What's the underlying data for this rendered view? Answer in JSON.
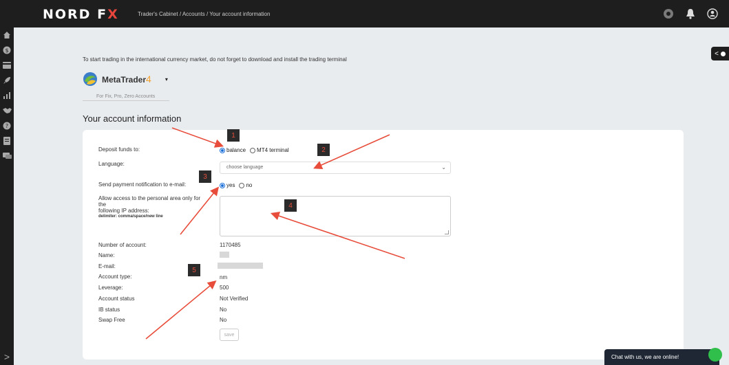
{
  "header": {
    "logo_part1": "NORD F",
    "logo_part2": "X",
    "breadcrumb": "Trader's Cabinet / Accounts / Your account information",
    "icons": [
      "support-icon",
      "bell-icon",
      "user-icon"
    ]
  },
  "sidebar": {
    "icons": [
      "home-icon",
      "dollar-icon",
      "card-icon",
      "rocket-icon",
      "chart-icon",
      "handshake-icon",
      "help-icon",
      "document-icon",
      "chat-icon"
    ],
    "expand_label": ">"
  },
  "collapse_tab": {
    "label": "<"
  },
  "intro": {
    "text": "To start trading in the international currency market, do not forget to download and install the trading terminal"
  },
  "terminal": {
    "name": "MetaTrader",
    "version": "4",
    "caret": "▾",
    "subtitle": "For Fix, Pro, Zero Accounts"
  },
  "section_title": "Your account information",
  "form": {
    "deposit_label": "Deposit funds to:",
    "deposit_options": [
      "balance",
      "MT4 terminal"
    ],
    "deposit_selected": "balance",
    "language_label": "Language:",
    "language_placeholder": "choose language",
    "notify_label": "Send payment notification to e-mail:",
    "notify_options": [
      "yes",
      "no"
    ],
    "notify_selected": "yes",
    "ip_label_1": "Allow access to the personal area only for the",
    "ip_label_2": "following IP address:",
    "ip_hint": "delimiter: comma/space/new line"
  },
  "details": {
    "account_number_label": "Number of account:",
    "account_number": "1170485",
    "name_label": "Name:",
    "email_label": "E-mail:",
    "account_type_label": "Account type:",
    "account_type": "nm",
    "leverage_label": "Leverage:",
    "leverage": "500",
    "status_label": "Account status",
    "status": "Not Verified",
    "ib_label": "IB status",
    "ib": "No",
    "swap_label": "Swap Free",
    "swap": "No"
  },
  "save_label": "save",
  "annotations": [
    "1",
    "2",
    "3",
    "4",
    "5"
  ],
  "annotation_color": "#e84d3b",
  "chat": {
    "text": "Chat with us, we are online!"
  }
}
